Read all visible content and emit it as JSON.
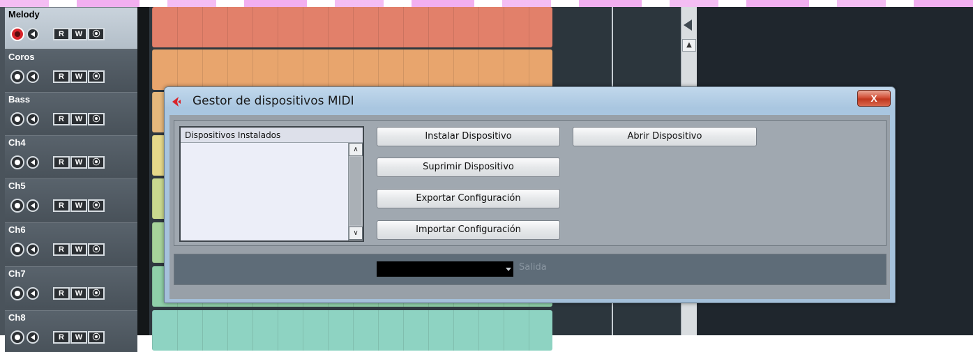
{
  "tracks": [
    {
      "name": "Melody",
      "selected": true,
      "record_on": true,
      "lane_color": "#e2806a"
    },
    {
      "name": "Coros",
      "selected": false,
      "record_on": false,
      "lane_color": "#e8a56d"
    },
    {
      "name": "Bass",
      "selected": false,
      "record_on": false,
      "lane_color": "#e5b87c"
    },
    {
      "name": "Ch4",
      "selected": false,
      "record_on": false,
      "lane_color": "#e6d98a"
    },
    {
      "name": "Ch5",
      "selected": false,
      "record_on": false,
      "lane_color": "#c9d98f"
    },
    {
      "name": "Ch6",
      "selected": false,
      "record_on": false,
      "lane_color": "#a6d39a"
    },
    {
      "name": "Ch7",
      "selected": false,
      "record_on": false,
      "lane_color": "#8fd0a9"
    },
    {
      "name": "Ch8",
      "selected": false,
      "record_on": false,
      "lane_color": "#8ed3c2"
    }
  ],
  "track_buttons": {
    "read": "R",
    "write": "W"
  },
  "dialog": {
    "title": "Gestor de dispositivos MIDI",
    "close_label": "X",
    "list_header": "Dispositivos Instalados",
    "buttons": {
      "install": "Instalar Dispositivo",
      "open": "Abrir Dispositivo",
      "remove": "Suprimir Dispositivo",
      "export": "Exportar Configuración",
      "import": "Importar Configuración"
    },
    "output_label": "Salida",
    "output_value": ""
  },
  "colors": {
    "record_active": "#d8242a",
    "close_button": "#c0381f",
    "dialog_frame": "#a9c6e0"
  }
}
